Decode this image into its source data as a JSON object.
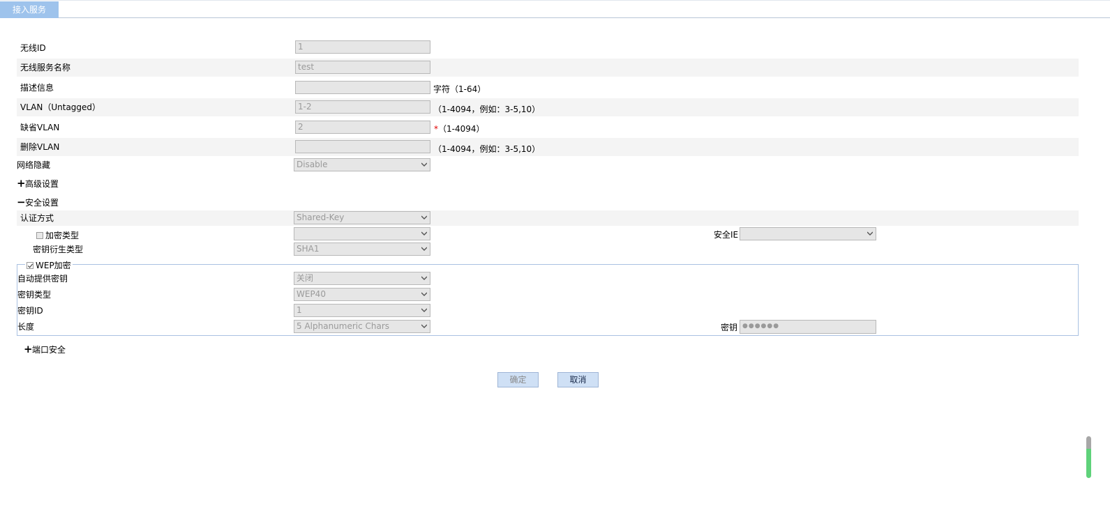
{
  "tab": {
    "label": "接入服务"
  },
  "form": {
    "wireless_id": {
      "label": "无线ID",
      "value": "1"
    },
    "service_name": {
      "label": "无线服务名称",
      "value": "test"
    },
    "description": {
      "label": "描述信息",
      "value": "",
      "hint": "字符（1-64）"
    },
    "vlan_untagged": {
      "label": "VLAN（Untagged）",
      "value": "1-2",
      "hint": "（1-4094，例如：3-5,10）"
    },
    "default_vlan": {
      "label": "缺省VLAN",
      "value": "2",
      "required_mark": "*",
      "hint": "（1-4094）"
    },
    "delete_vlan": {
      "label": "删除VLAN",
      "value": "",
      "hint": "（1-4094，例如：3-5,10）"
    },
    "network_hide": {
      "label": "网络隐藏",
      "value": "Disable"
    }
  },
  "advanced": {
    "toggle": "+",
    "label": "高级设置"
  },
  "security": {
    "toggle": "−",
    "label": "安全设置",
    "auth_method": {
      "label": "认证方式",
      "value": "Shared-Key"
    },
    "encrypt_type": {
      "label": "加密类型",
      "value": ""
    },
    "security_ie": {
      "label": "安全IE",
      "value": ""
    },
    "key_derive": {
      "label": "密钥衍生类型",
      "value": "SHA1"
    }
  },
  "wep": {
    "legend": "WEP加密",
    "auto_key": {
      "label": "自动提供密钥",
      "value": "关闭"
    },
    "key_type": {
      "label": "密钥类型",
      "value": "WEP40"
    },
    "key_id": {
      "label": "密钥ID",
      "value": "1"
    },
    "length": {
      "label": "长度",
      "value": "5 Alphanumeric Chars"
    },
    "key": {
      "label": "密钥",
      "value": "●●●●●●"
    }
  },
  "port_security": {
    "toggle": "+",
    "label": "端口安全"
  },
  "buttons": {
    "ok": "确定",
    "cancel": "取消"
  }
}
